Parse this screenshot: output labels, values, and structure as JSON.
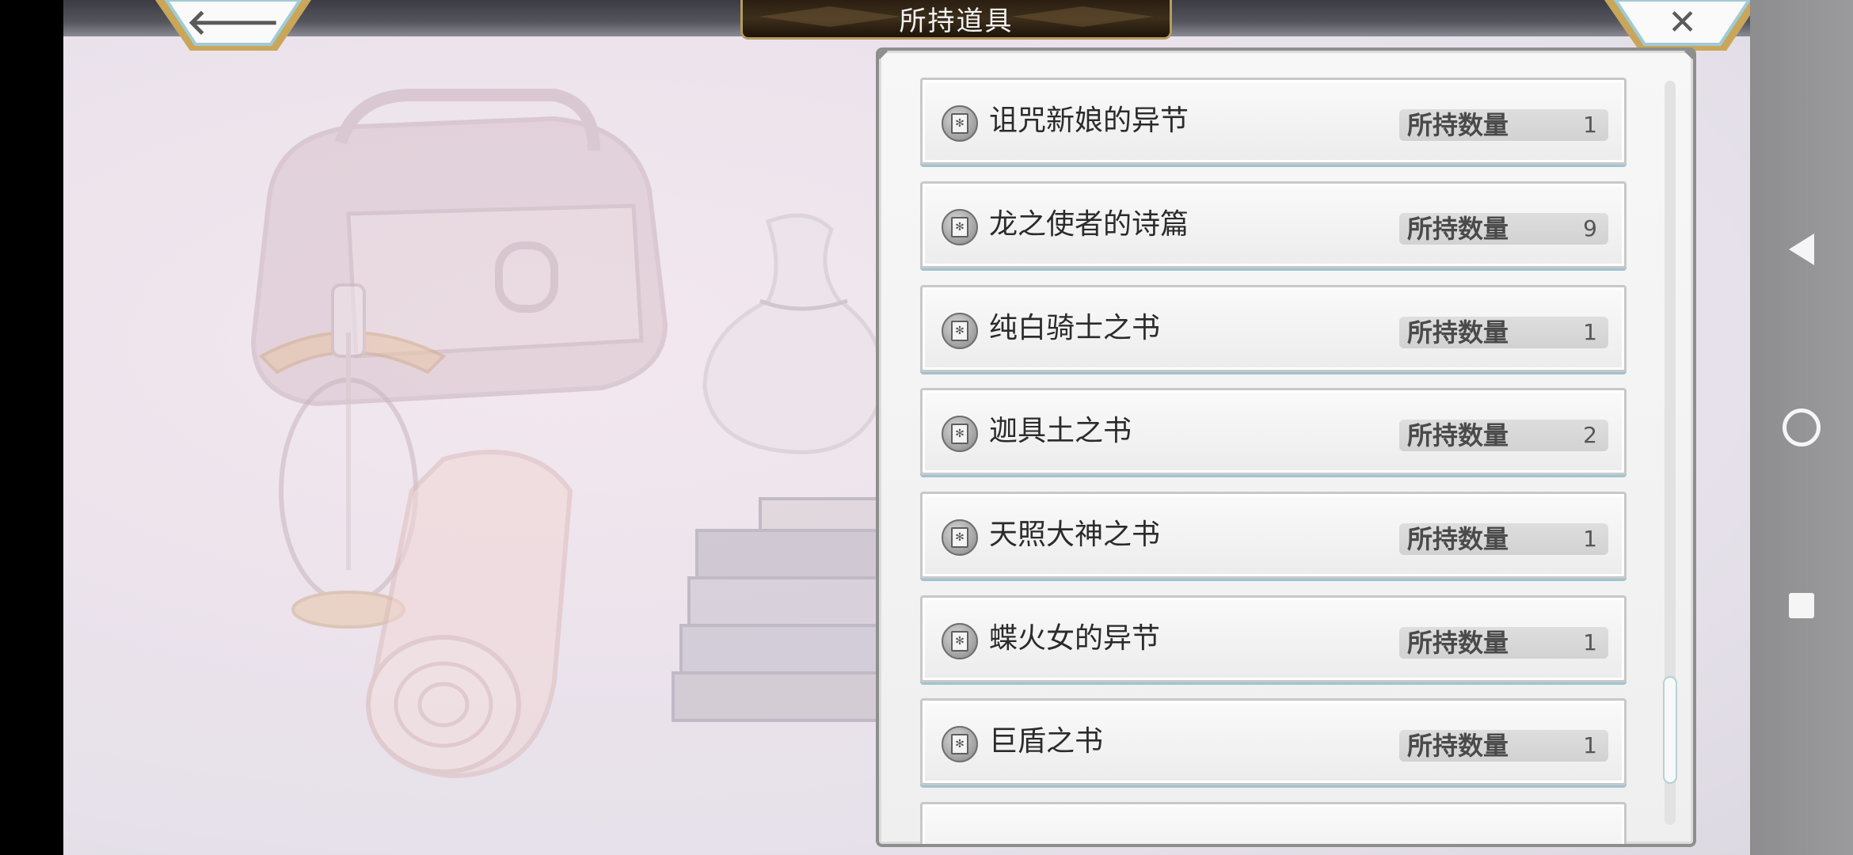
{
  "header": {
    "title": "所持道具",
    "back_icon": "arrow-left-icon",
    "close_icon": "close-icon"
  },
  "items": [
    {
      "name": "诅咒新娘的异节",
      "qty_label": "所持数量",
      "qty": "1",
      "icon": "book-icon"
    },
    {
      "name": "龙之使者的诗篇",
      "qty_label": "所持数量",
      "qty": "9",
      "icon": "book-icon"
    },
    {
      "name": "纯白骑士之书",
      "qty_label": "所持数量",
      "qty": "1",
      "icon": "book-icon"
    },
    {
      "name": "迦具土之书",
      "qty_label": "所持数量",
      "qty": "2",
      "icon": "book-icon"
    },
    {
      "name": "天照大神之书",
      "qty_label": "所持数量",
      "qty": "1",
      "icon": "book-icon"
    },
    {
      "name": "蝶火女的异节",
      "qty_label": "所持数量",
      "qty": "1",
      "icon": "book-icon"
    },
    {
      "name": "巨盾之书",
      "qty_label": "所持数量",
      "qty": "1",
      "icon": "book-icon"
    }
  ],
  "colors": {
    "accent_gold": "#b79b60",
    "row_bottom_glow": "#9fc4cf",
    "panel_border": "#8e8e8e"
  },
  "system_nav": {
    "back_icon": "triangle-back-icon",
    "home_icon": "circle-home-icon",
    "recent_icon": "square-recents-icon"
  }
}
